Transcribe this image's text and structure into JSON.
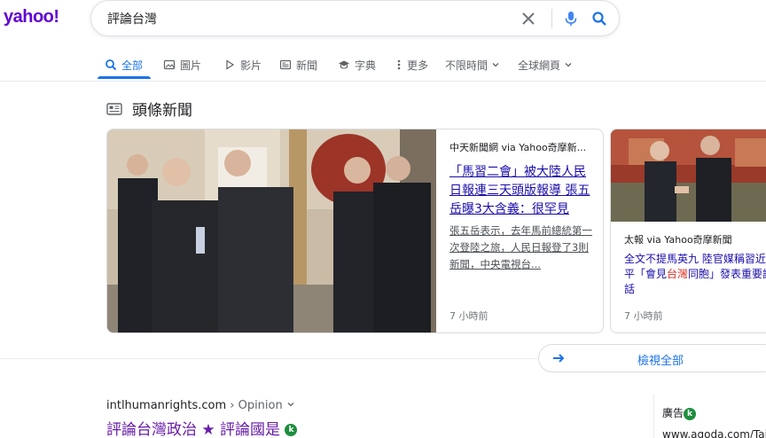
{
  "brand": {
    "logo": "yahoo!",
    "color": "#6001d2"
  },
  "search": {
    "query": "評論台灣"
  },
  "tabs": [
    {
      "label": "全部",
      "icon": "search-icon",
      "active": true
    },
    {
      "label": "圖片",
      "icon": "image-icon"
    },
    {
      "label": "影片",
      "icon": "play-icon"
    },
    {
      "label": "新聞",
      "icon": "news-icon"
    },
    {
      "label": "字典",
      "icon": "graduation-cap-icon"
    },
    {
      "label": "更多",
      "icon": "more-vert-icon"
    },
    {
      "label": "不限時間",
      "icon": "chevron-down-icon"
    },
    {
      "label": "全球網頁",
      "icon": "chevron-down-icon"
    }
  ],
  "top_stories": {
    "heading": "頭條新聞",
    "cards": [
      {
        "source": "中天新聞網 via Yahoo奇摩新...",
        "headline": "「馬習二會」被大陸人民日報連三天頭版報導 張五岳曝3大含義：很罕見",
        "snippet": "張五岳表示，去年馬前總統第一次登陸之旅，人民日報登了3則新聞，中央電視台...",
        "time": "7 小時前"
      },
      {
        "source": "太報 via Yahoo奇摩新聞",
        "headline_pre": "全文不提馬英九 陸官媒稱習近平「會見",
        "headline_hl": "台灣",
        "headline_post": "同胞」發表重要談話",
        "time": "7 小時前"
      }
    ],
    "view_all": "檢視全部"
  },
  "result": {
    "cite_domain": "intlhumanrights.com",
    "cite_path": " › Opinion",
    "title": "評論台灣政治 ★ 評論國是",
    "badge": "k"
  },
  "ad": {
    "label": "廣告",
    "badge": "k",
    "url": "www.agoda.com/Tai"
  }
}
